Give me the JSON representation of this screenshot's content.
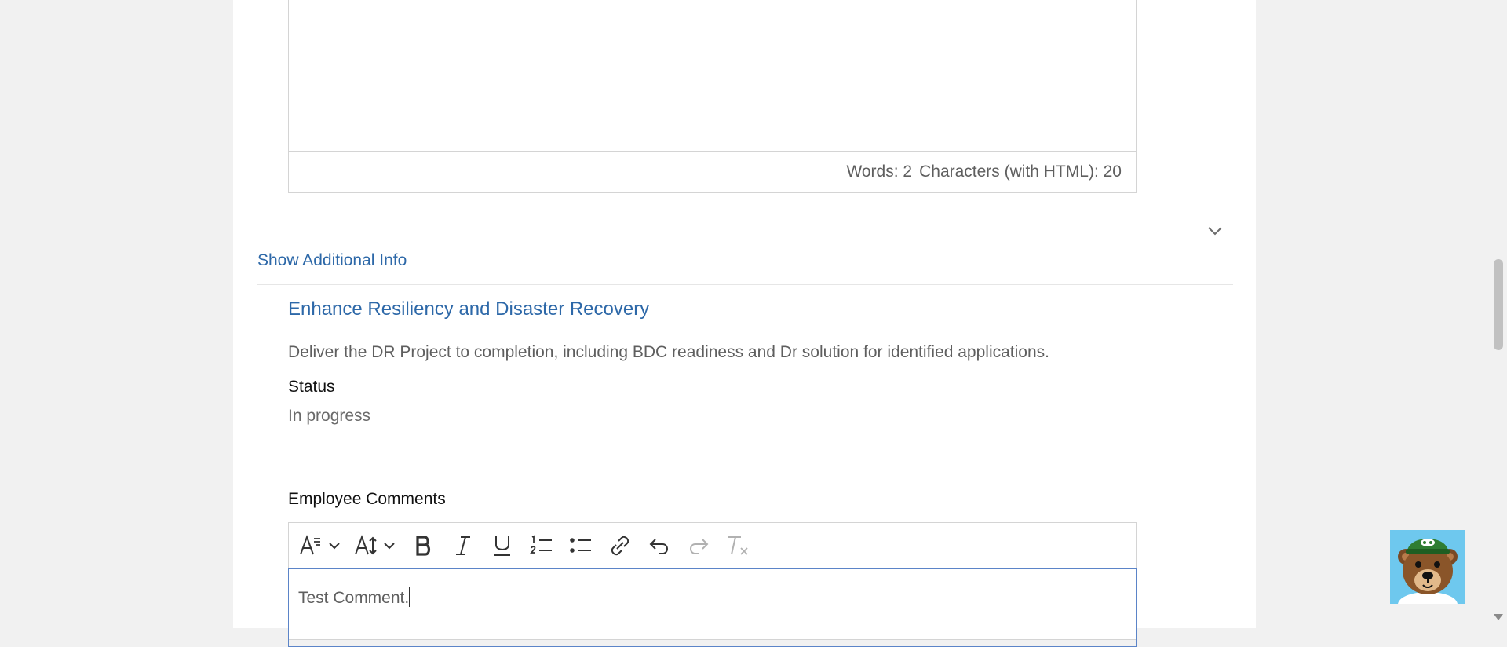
{
  "top_editor": {
    "word_count": "Words: 2",
    "char_count": "Characters (with HTML): 20"
  },
  "additional_info": {
    "toggle_label": "Show Additional Info"
  },
  "goal": {
    "title": "Enhance Resiliency and Disaster Recovery",
    "description": "Deliver the DR Project to completion, including BDC readiness and Dr solution for identified applications.",
    "status_label": "Status",
    "status_value": "In progress"
  },
  "comments": {
    "label": "Employee Comments",
    "value": "Test Comment.",
    "toolbar": [
      {
        "name": "font-style-icon"
      },
      {
        "name": "font-size-icon"
      },
      {
        "name": "bold-icon"
      },
      {
        "name": "italic-icon"
      },
      {
        "name": "underline-icon"
      },
      {
        "name": "numbered-list-icon"
      },
      {
        "name": "bulleted-list-icon"
      },
      {
        "name": "link-icon"
      },
      {
        "name": "undo-icon"
      },
      {
        "name": "redo-icon"
      },
      {
        "name": "clear-format-icon"
      }
    ]
  },
  "colors": {
    "link": "#2d68a8",
    "text": "#5f5f5f",
    "focus_border": "#5b84c8",
    "mascot_bg": "#6ec8ee"
  },
  "mascot": {
    "icon": "bear-mascot-icon"
  }
}
